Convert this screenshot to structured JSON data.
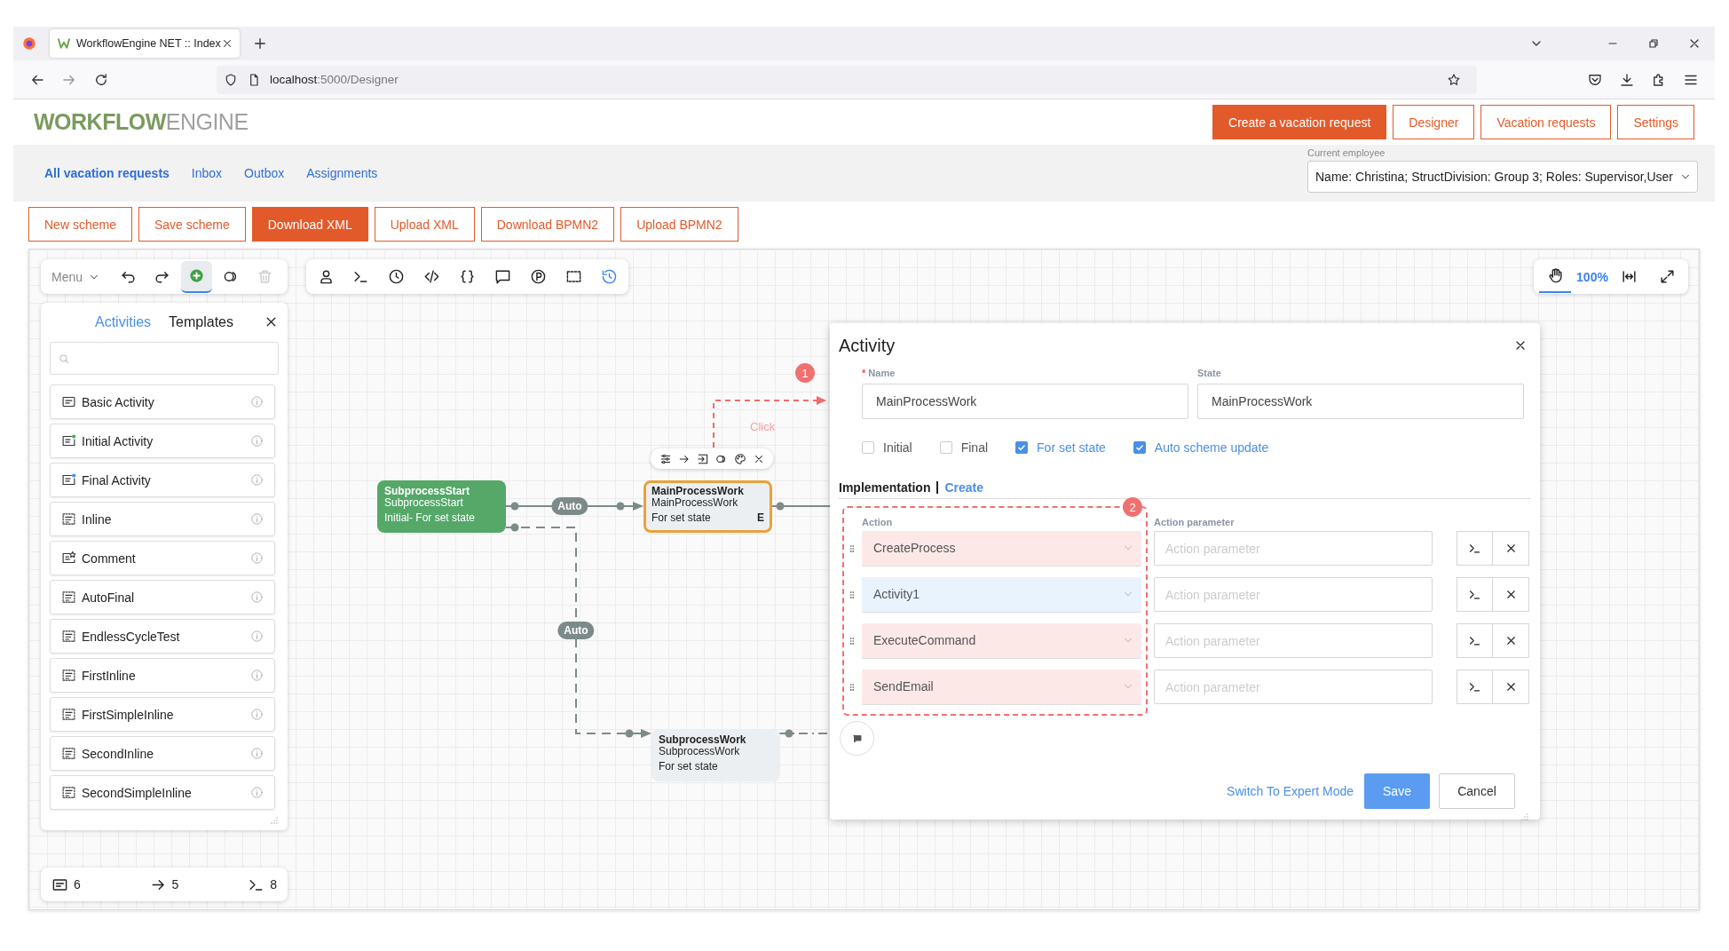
{
  "browser": {
    "tab_title": "WorkflowEngine NET :: Index",
    "url_host": "localhost",
    "url_path": ":5000/Designer"
  },
  "header": {
    "logo_main": "WORKFLOW",
    "logo_light": "ENGINE",
    "buttons": [
      {
        "label": "Create a vacation request",
        "selected": true
      },
      {
        "label": "Designer",
        "selected": false
      },
      {
        "label": "Vacation requests",
        "selected": false
      },
      {
        "label": "Settings",
        "selected": false
      }
    ]
  },
  "nav": {
    "links": [
      {
        "label": "All vacation requests",
        "selected": true
      },
      {
        "label": "Inbox",
        "selected": false
      },
      {
        "label": "Outbox",
        "selected": false
      },
      {
        "label": "Assignments",
        "selected": false
      }
    ],
    "employee_label": "Current employee",
    "employee_value": "Name: Christina; StructDivision: Group 3; Roles: Supervisor,User"
  },
  "scheme_buttons": [
    {
      "label": "New scheme",
      "selected": false
    },
    {
      "label": "Save scheme",
      "selected": false
    },
    {
      "label": "Download XML",
      "selected": true
    },
    {
      "label": "Upload XML",
      "selected": false
    },
    {
      "label": "Download BPMN2",
      "selected": false
    },
    {
      "label": "Upload BPMN2",
      "selected": false
    }
  ],
  "designer": {
    "menu_label": "Menu",
    "left_tools": [
      {
        "kind": "undo",
        "selected": false,
        "disabled": false
      },
      {
        "kind": "redo",
        "selected": false,
        "disabled": false
      },
      {
        "kind": "add",
        "selected": true,
        "disabled": false
      },
      {
        "kind": "toggle",
        "selected": false,
        "disabled": false
      },
      {
        "kind": "delete",
        "selected": false,
        "disabled": true
      }
    ],
    "center_tools": [
      {
        "kind": "actor",
        "selected": false
      },
      {
        "kind": "command",
        "selected": false
      },
      {
        "kind": "timer",
        "selected": false
      },
      {
        "kind": "code",
        "selected": false
      },
      {
        "kind": "parameters",
        "selected": false
      },
      {
        "kind": "comment",
        "selected": false
      },
      {
        "kind": "circled-p",
        "selected": false
      },
      {
        "kind": "select",
        "selected": false
      },
      {
        "kind": "history",
        "selected": true
      }
    ],
    "pan_selected": true,
    "zoom": "100%",
    "panel": {
      "tabs": [
        {
          "label": "Activities",
          "selected": true
        },
        {
          "label": "Templates",
          "selected": false
        }
      ],
      "items": [
        {
          "label": "Basic Activity",
          "kind": "basic"
        },
        {
          "label": "Initial Activity",
          "kind": "initial"
        },
        {
          "label": "Final Activity",
          "kind": "final"
        },
        {
          "label": "Inline",
          "kind": "inline"
        },
        {
          "label": "Comment",
          "kind": "comment"
        },
        {
          "label": "AutoFinal",
          "kind": "inline"
        },
        {
          "label": "EndlessCycleTest",
          "kind": "inline"
        },
        {
          "label": "FirstInline",
          "kind": "inline"
        },
        {
          "label": "FirstSimpleInline",
          "kind": "inline"
        },
        {
          "label": "SecondInline",
          "kind": "inline"
        },
        {
          "label": "SecondSimpleInline",
          "kind": "inline"
        }
      ]
    },
    "stats": [
      {
        "kind": "activities",
        "count": "6"
      },
      {
        "kind": "transitions",
        "count": "5"
      },
      {
        "kind": "commands",
        "count": "8"
      }
    ],
    "nodes": [
      {
        "title": "SubprocessStart",
        "state": "SubprocessStart",
        "info": "Initial- For set state",
        "kind": "initial",
        "selected": false
      },
      {
        "title": "MainProcessWork",
        "state": "MainProcessWork",
        "info": "For set state",
        "marker": "E",
        "kind": "normal",
        "selected": true
      },
      {
        "title": "SubprocessWork",
        "state": "SubprocessWork",
        "info": "For set state",
        "kind": "normal",
        "selected": false
      }
    ],
    "node_tools": [
      {
        "kind": "settings"
      },
      {
        "kind": "transition"
      },
      {
        "kind": "inline"
      },
      {
        "kind": "toggle"
      },
      {
        "kind": "palette"
      },
      {
        "kind": "close"
      }
    ],
    "transition_labels": [
      "Auto",
      "Auto"
    ],
    "hint": {
      "badge": "1",
      "text": "Click"
    }
  },
  "dialog": {
    "title": "Activity",
    "name_label": "Name",
    "required_mark": "*",
    "name_value": "MainProcessWork",
    "state_label": "State",
    "state_value": "MainProcessWork",
    "checkboxes": [
      {
        "label": "Initial",
        "checked": false
      },
      {
        "label": "Final",
        "checked": false
      },
      {
        "label": "For set state",
        "checked": true
      },
      {
        "label": "Auto scheme update",
        "checked": true
      }
    ],
    "implementation_label": "Implementation",
    "create_link": "Create",
    "action_header": "Action",
    "param_header": "Action parameter",
    "badge": "2",
    "actions": [
      {
        "action": "CreateProcess",
        "placeholder": "Action parameter",
        "color": "#fde8e8"
      },
      {
        "action": "Activity1",
        "placeholder": "Action parameter",
        "color": "#e8f3fe"
      },
      {
        "action": "ExecuteCommand",
        "placeholder": "Action parameter",
        "color": "#fde8e8"
      },
      {
        "action": "SendEmail",
        "placeholder": "Action parameter",
        "color": "#fde8e8"
      }
    ],
    "expert_link": "Switch To Expert Mode",
    "save": "Save",
    "cancel": "Cancel"
  }
}
